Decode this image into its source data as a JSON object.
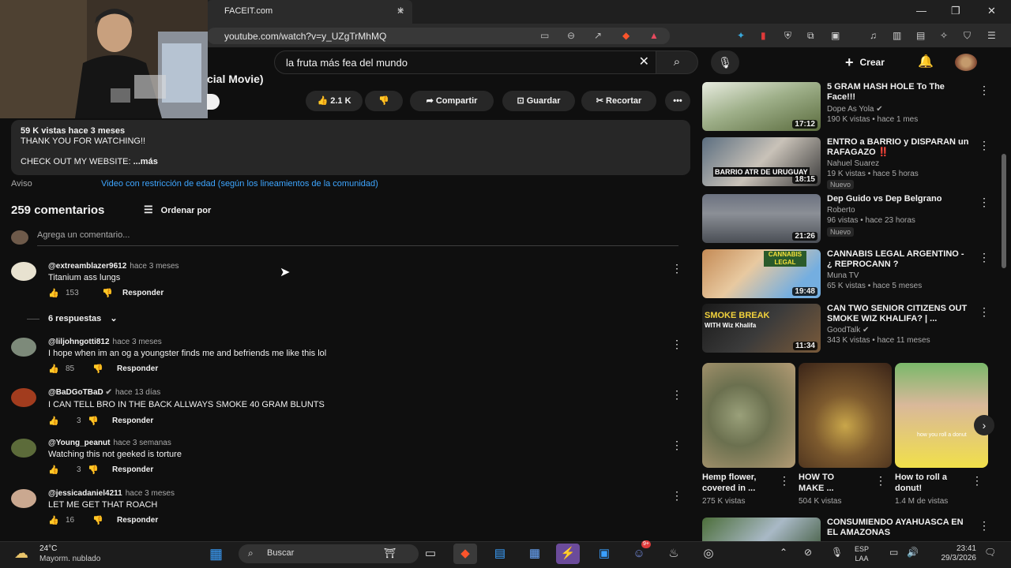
{
  "browser": {
    "tab_title": "FACEIT.com",
    "new_tab": "+",
    "url": "youtube.com/watch?v=y_UZgTrMhMQ",
    "minimize": "—",
    "maximize": "❐",
    "close": "✕"
  },
  "header": {
    "search_query": "la fruta más fea del mundo",
    "create_label": "Crear"
  },
  "video": {
    "title_fragment": "cial Movie)",
    "likes": "2.1 K",
    "share_label": "Compartir",
    "save_label": "Guardar",
    "clip_label": "Recortar"
  },
  "description": {
    "meta": "59 K vistas  hace 3 meses",
    "line1": "THANK YOU FOR WATCHING!!",
    "line2": "CHECK OUT MY WEBSITE:",
    "more": "...más"
  },
  "notice": {
    "label": "Aviso",
    "link": "Video con restricción de edad (según los lineamientos de la comunidad)"
  },
  "comments": {
    "count_label": "259 comentarios",
    "sort_label": "Ordenar por",
    "add_placeholder": "Agrega un comentario...",
    "reply_label": "Responder",
    "replies_toggle": "6 respuestas",
    "items": [
      {
        "user": "@extreamblazer9612",
        "time": "hace 3 meses",
        "text": "Titanium ass lungs",
        "likes": "153"
      },
      {
        "user": "@liljohngotti812",
        "time": "hace 3 meses",
        "text": "I hope when im an og a youngster finds me and befriends me like this lol",
        "likes": "85"
      },
      {
        "user": "@BaDGoTBaD",
        "time": "hace 13 días",
        "text": "I CAN TELL BRO IN THE BACK ALLWAYS SMOKE 40 GRAM BLUNTS",
        "likes": "3"
      },
      {
        "user": "@Young_peanut",
        "time": "hace 3 semanas",
        "text": "Watching this not geeked is torture",
        "likes": "3"
      },
      {
        "user": "@jessicadaniel4211",
        "time": "hace 3 meses",
        "text": "LET ME GET THAT ROACH",
        "likes": "16"
      }
    ]
  },
  "sidebar": {
    "items": [
      {
        "title": "5 GRAM HASH HOLE To The Face!!!",
        "channel": "Dope As Yola",
        "stats": "190 K vistas • hace 1 mes",
        "duration": "17:12",
        "badge": ""
      },
      {
        "title": "ENTRO a BARRIO y DISPARAN un RAFAGAZO ‼️",
        "channel": "Nahuel Suarez",
        "stats": "19 K vistas • hace 5 horas",
        "duration": "18:15",
        "badge": "Nuevo"
      },
      {
        "title": "Dep Guido vs Dep Belgrano",
        "channel": "Roberto",
        "stats": "96 vistas • hace 23 horas",
        "duration": "21:26",
        "badge": "Nuevo"
      },
      {
        "title": "CANNABIS LEGAL ARGENTINO - ¿ REPROCANN ?",
        "channel": "Muna TV",
        "stats": "65 K vistas • hace 5 meses",
        "duration": "19:48",
        "badge": ""
      },
      {
        "title": "CAN TWO SENIOR CITIZENS OUT SMOKE WIZ KHALIFA? | ...",
        "channel": "GoodTalk",
        "stats": "343 K vistas • hace 11 meses",
        "duration": "11:34",
        "badge": ""
      }
    ],
    "thumb_texts": {
      "barrio": "BARRIO ATR DE URUGUAY",
      "cannabis": "CANNABIS LEGAL",
      "smoke": "SMOKE BREAK",
      "wiz": "WITH Wiz Khalifa",
      "short_overlay": "how you roll a donut"
    },
    "shorts": [
      {
        "title": "Hemp flower, covered in ...",
        "views": "275 K vistas"
      },
      {
        "title": "HOW TO MAKE ...",
        "views": "504 K vistas"
      },
      {
        "title": "How to roll a donut!",
        "views": "1.4 M de vistas"
      }
    ],
    "last_item": {
      "title": "CONSUMIENDO AYAHUASCA EN EL AMAZONAS"
    }
  },
  "taskbar": {
    "temp": "24°C",
    "condition": "Mayorm. nublado",
    "search_label": "Buscar",
    "lang1": "ESP",
    "lang2": "LAA",
    "time": "23:41",
    "date": "29/3/2026",
    "discord_badge": "9+"
  }
}
